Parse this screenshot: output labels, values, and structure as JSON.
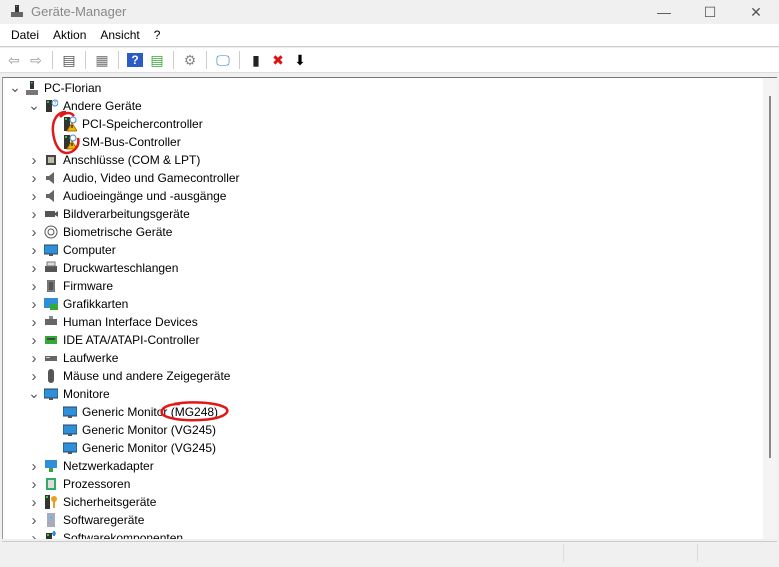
{
  "window": {
    "title": "Geräte-Manager",
    "minimize": "—",
    "maximize": "☐",
    "close": "✕"
  },
  "menu": [
    "Datei",
    "Aktion",
    "Ansicht",
    "?"
  ],
  "toolbar": [
    {
      "icon": "back-arrow-icon",
      "glyph": "⇦",
      "color": "#999"
    },
    {
      "icon": "forward-arrow-icon",
      "glyph": "⇨",
      "color": "#999"
    },
    {
      "sep": true
    },
    {
      "icon": "show-hide-console-tree-icon",
      "glyph": "▤",
      "color": "#555"
    },
    {
      "sep": true
    },
    {
      "icon": "properties-icon",
      "glyph": "▦",
      "color": "#777"
    },
    {
      "sep": true
    },
    {
      "icon": "help-icon",
      "glyph": "?",
      "color": "#fff",
      "bg": "#2b5bc4"
    },
    {
      "icon": "action-pane-icon",
      "glyph": "▤",
      "color": "#3a3"
    },
    {
      "sep": true
    },
    {
      "icon": "update-driver-icon",
      "glyph": "⚙",
      "color": "#888"
    },
    {
      "sep": true
    },
    {
      "icon": "scan-hardware-icon",
      "glyph": "🖵",
      "color": "#3a7fc0"
    },
    {
      "sep": true
    },
    {
      "icon": "add-driver-icon",
      "glyph": "▮",
      "color": "#222"
    },
    {
      "icon": "uninstall-icon",
      "glyph": "✖",
      "color": "#e01010"
    },
    {
      "icon": "disable-device-icon",
      "glyph": "⬇",
      "color": "#000"
    }
  ],
  "tree": [
    {
      "level": 0,
      "state": "open",
      "label": "PC-Florian",
      "icon": "computer-icon"
    },
    {
      "level": 1,
      "state": "open",
      "label": "Andere Geräte",
      "icon": "unknown-device-icon"
    },
    {
      "level": 2,
      "state": "leaf",
      "label": "PCI-Speichercontroller",
      "icon": "warning-device-icon"
    },
    {
      "level": 2,
      "state": "leaf",
      "label": "SM-Bus-Controller",
      "icon": "warning-device-icon"
    },
    {
      "level": 1,
      "state": "closed",
      "label": "Anschlüsse (COM & LPT)",
      "icon": "port-icon"
    },
    {
      "level": 1,
      "state": "closed",
      "label": "Audio, Video und Gamecontroller",
      "icon": "speaker-icon"
    },
    {
      "level": 1,
      "state": "closed",
      "label": "Audioeingänge und -ausgänge",
      "icon": "speaker-icon"
    },
    {
      "level": 1,
      "state": "closed",
      "label": "Bildverarbeitungsgeräte",
      "icon": "camera-icon"
    },
    {
      "level": 1,
      "state": "closed",
      "label": "Biometrische Geräte",
      "icon": "fingerprint-icon"
    },
    {
      "level": 1,
      "state": "closed",
      "label": "Computer",
      "icon": "monitor-icon"
    },
    {
      "level": 1,
      "state": "closed",
      "label": "Druckwarteschlangen",
      "icon": "printer-icon"
    },
    {
      "level": 1,
      "state": "closed",
      "label": "Firmware",
      "icon": "chip-icon"
    },
    {
      "level": 1,
      "state": "closed",
      "label": "Grafikkarten",
      "icon": "display-adapter-icon"
    },
    {
      "level": 1,
      "state": "closed",
      "label": "Human Interface Devices",
      "icon": "hid-icon"
    },
    {
      "level": 1,
      "state": "closed",
      "label": "IDE ATA/ATAPI-Controller",
      "icon": "ide-controller-icon"
    },
    {
      "level": 1,
      "state": "closed",
      "label": "Laufwerke",
      "icon": "drive-icon"
    },
    {
      "level": 1,
      "state": "closed",
      "label": "Mäuse und andere Zeigegeräte",
      "icon": "mouse-icon"
    },
    {
      "level": 1,
      "state": "open",
      "label": "Monitore",
      "icon": "monitor-icon"
    },
    {
      "level": 2,
      "state": "leaf",
      "label": "Generic Monitor (MG248)",
      "icon": "monitor-icon"
    },
    {
      "level": 2,
      "state": "leaf",
      "label": "Generic Monitor (VG245)",
      "icon": "monitor-icon"
    },
    {
      "level": 2,
      "state": "leaf",
      "label": "Generic Monitor (VG245)",
      "icon": "monitor-icon"
    },
    {
      "level": 1,
      "state": "closed",
      "label": "Netzwerkadapter",
      "icon": "network-icon"
    },
    {
      "level": 1,
      "state": "closed",
      "label": "Prozessoren",
      "icon": "processor-icon"
    },
    {
      "level": 1,
      "state": "closed",
      "label": "Sicherheitsgeräte",
      "icon": "security-key-icon"
    },
    {
      "level": 1,
      "state": "closed",
      "label": "Softwaregeräte",
      "icon": "software-device-icon"
    },
    {
      "level": 1,
      "state": "closed",
      "label": "Softwarekomponenten",
      "icon": "software-component-icon"
    }
  ],
  "colors": {
    "annotation": "#e01818",
    "warning": "#f2b600",
    "monitor": "#2f8fd8"
  }
}
